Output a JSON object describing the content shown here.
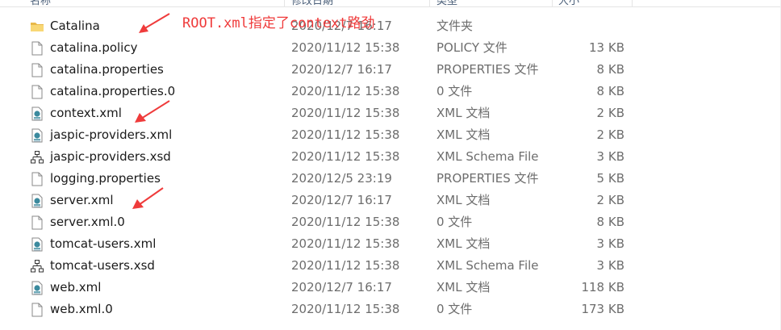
{
  "header": {
    "columns": [
      "名称",
      "修改日期",
      "类型",
      "大小"
    ]
  },
  "annotation": {
    "text": "ROOT.xml指定了context路劲",
    "color": "#ef3b3b"
  },
  "files": [
    {
      "name": "Catalina",
      "date": "2020/12/7 16:17",
      "type": "文件夹",
      "size": "",
      "icon": "folder-icon"
    },
    {
      "name": "catalina.policy",
      "date": "2020/11/12 15:38",
      "type": "POLICY 文件",
      "size": "13 KB",
      "icon": "file-icon"
    },
    {
      "name": "catalina.properties",
      "date": "2020/12/7 16:17",
      "type": "PROPERTIES 文件",
      "size": "8 KB",
      "icon": "file-icon"
    },
    {
      "name": "catalina.properties.0",
      "date": "2020/11/12 15:38",
      "type": "0 文件",
      "size": "8 KB",
      "icon": "file-icon"
    },
    {
      "name": "context.xml",
      "date": "2020/11/12 15:38",
      "type": "XML 文档",
      "size": "2 KB",
      "icon": "xml-file-icon"
    },
    {
      "name": "jaspic-providers.xml",
      "date": "2020/11/12 15:38",
      "type": "XML 文档",
      "size": "2 KB",
      "icon": "xml-file-icon"
    },
    {
      "name": "jaspic-providers.xsd",
      "date": "2020/11/12 15:38",
      "type": "XML Schema File",
      "size": "3 KB",
      "icon": "xsd-file-icon"
    },
    {
      "name": "logging.properties",
      "date": "2020/12/5 23:19",
      "type": "PROPERTIES 文件",
      "size": "5 KB",
      "icon": "file-icon"
    },
    {
      "name": "server.xml",
      "date": "2020/12/7 16:17",
      "type": "XML 文档",
      "size": "2 KB",
      "icon": "xml-file-icon"
    },
    {
      "name": "server.xml.0",
      "date": "2020/11/12 15:38",
      "type": "0 文件",
      "size": "8 KB",
      "icon": "file-icon"
    },
    {
      "name": "tomcat-users.xml",
      "date": "2020/11/12 15:38",
      "type": "XML 文档",
      "size": "3 KB",
      "icon": "xml-file-icon"
    },
    {
      "name": "tomcat-users.xsd",
      "date": "2020/11/12 15:38",
      "type": "XML Schema File",
      "size": "3 KB",
      "icon": "xsd-file-icon"
    },
    {
      "name": "web.xml",
      "date": "2020/12/7 16:17",
      "type": "XML 文档",
      "size": "118 KB",
      "icon": "xml-file-icon"
    },
    {
      "name": "web.xml.0",
      "date": "2020/11/12 15:38",
      "type": "0 文件",
      "size": "173 KB",
      "icon": "file-icon"
    }
  ]
}
